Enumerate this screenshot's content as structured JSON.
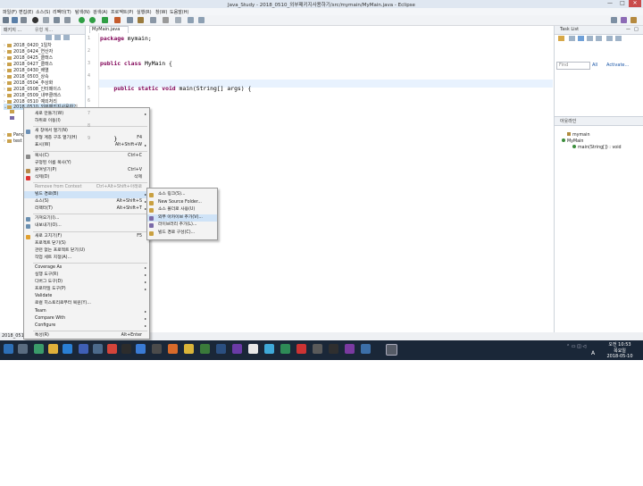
{
  "window": {
    "title": "Java_Study - 2018_0510_외부패키지사용하기/src/mymain/MyMain.java - Eclipse",
    "minimize": "—",
    "maximize": "□",
    "close": "✕"
  },
  "menubar": [
    "파일(F)",
    "편집(E)",
    "소스(S)",
    "리팩터(T)",
    "탐색(N)",
    "검색(A)",
    "프로젝트(P)",
    "실행(R)",
    "창(W)",
    "도움말(H)"
  ],
  "quick_access": "빠른 액세스",
  "package_explorer": {
    "tab_label": "패키지 ...",
    "tab2_label": "유형 계...",
    "items": [
      "2018_0420_1일차",
      "2018_0424_연산자",
      "2018_0425_클래스",
      "2018_0427_클래스",
      "2018_0430_배열",
      "2018_0503_상속",
      "2018_0504_추상화",
      "2018_0508_인터페이스",
      "2018_0509_내부클래스",
      "2018_0510_예외처리",
      "2018_0510_외부패키지사용하기"
    ],
    "extra_items": [
      "Pang",
      "test"
    ],
    "statusbar_label": "2018_0510_"
  },
  "editor": {
    "tab_label": "MyMain.java",
    "lines": [
      {
        "no": "1",
        "parts": [
          {
            "kw": true,
            "t": "package"
          },
          {
            "kw": false,
            "t": " mymain;"
          }
        ]
      },
      {
        "no": "2",
        "parts": []
      },
      {
        "no": "3",
        "parts": [
          {
            "kw": true,
            "t": "public class"
          },
          {
            "kw": false,
            "t": " MyMain {"
          }
        ]
      },
      {
        "no": "4",
        "parts": []
      },
      {
        "no": "5",
        "parts": [
          {
            "kw": false,
            "t": "    "
          },
          {
            "kw": true,
            "t": "public static void"
          },
          {
            "kw": false,
            "t": " main(String[] args) {"
          }
        ]
      },
      {
        "no": "6",
        "parts": []
      },
      {
        "no": "7",
        "parts": []
      },
      {
        "no": "8",
        "parts": []
      },
      {
        "no": "9",
        "parts": [
          {
            "kw": false,
            "t": "    }"
          }
        ]
      }
    ]
  },
  "task_list": {
    "title": "Task List",
    "find_placeholder": "Find",
    "all_label": "All",
    "activate_label": "Activate..."
  },
  "outline": {
    "title": "아웃라인",
    "items": [
      "mymain",
      "MyMain",
      "main(String[]) : void"
    ]
  },
  "context_menu": {
    "items": [
      {
        "label": "새로 만들기(W)",
        "shortcut": "",
        "submenu": true,
        "disabled": false
      },
      {
        "label": "하위로 이동(I)",
        "shortcut": "",
        "submenu": false,
        "disabled": false
      },
      {
        "sep": true
      },
      {
        "label": "새 창에서 열기(N)",
        "shortcut": "",
        "submenu": false,
        "disabled": false
      },
      {
        "label": "유형 계층 구조 열기(H)",
        "shortcut": "F4",
        "submenu": false,
        "disabled": false
      },
      {
        "label": "표시(W)",
        "shortcut": "Alt+Shift+W",
        "submenu": true,
        "disabled": false
      },
      {
        "sep": true
      },
      {
        "label": "복사(C)",
        "shortcut": "Ctrl+C",
        "submenu": false,
        "disabled": false
      },
      {
        "label": "규정된 이름 복사(Y)",
        "shortcut": "",
        "submenu": false,
        "disabled": false
      },
      {
        "label": "붙여넣기(P)",
        "shortcut": "Ctrl+V",
        "submenu": false,
        "disabled": false
      },
      {
        "label": "삭제(D)",
        "shortcut": "삭제",
        "submenu": false,
        "disabled": false
      },
      {
        "sep": true
      },
      {
        "label": "Remove from Context",
        "shortcut": "Ctrl+Alt+Shift+아래로",
        "submenu": false,
        "disabled": true
      },
      {
        "label": "빌드 경로(B)",
        "shortcut": "",
        "submenu": true,
        "disabled": false,
        "highlight": true
      },
      {
        "label": "소스(S)",
        "shortcut": "Alt+Shift+S",
        "submenu": true,
        "disabled": false
      },
      {
        "label": "리팩터(T)",
        "shortcut": "Alt+Shift+T",
        "submenu": true,
        "disabled": false
      },
      {
        "sep": true
      },
      {
        "label": "가져오기(I)...",
        "shortcut": "",
        "submenu": false,
        "disabled": false
      },
      {
        "label": "내보내기(O)...",
        "shortcut": "",
        "submenu": false,
        "disabled": false
      },
      {
        "sep": true
      },
      {
        "label": "새로 고치기(F)",
        "shortcut": "F5",
        "submenu": false,
        "disabled": false
      },
      {
        "label": "프로젝트 닫기(S)",
        "shortcut": "",
        "submenu": false,
        "disabled": false
      },
      {
        "label": "관련 없는 프로젝트 닫기(U)",
        "shortcut": "",
        "submenu": false,
        "disabled": false
      },
      {
        "label": "작업 세트 지정(A)...",
        "shortcut": "",
        "submenu": false,
        "disabled": false
      },
      {
        "sep": true
      },
      {
        "label": "Coverage As",
        "shortcut": "",
        "submenu": true,
        "disabled": false
      },
      {
        "label": "실행 도구(R)",
        "shortcut": "",
        "submenu": true,
        "disabled": false
      },
      {
        "label": "디버그 도구(D)",
        "shortcut": "",
        "submenu": true,
        "disabled": false
      },
      {
        "label": "프로파일 도구(P)",
        "shortcut": "",
        "submenu": true,
        "disabled": false
      },
      {
        "label": "Validate",
        "shortcut": "",
        "submenu": false,
        "disabled": false
      },
      {
        "label": "로컬 히스토리로부터 복원(Y)...",
        "shortcut": "",
        "submenu": false,
        "disabled": false
      },
      {
        "label": "Team",
        "shortcut": "",
        "submenu": true,
        "disabled": false
      },
      {
        "label": "Compare With",
        "shortcut": "",
        "submenu": true,
        "disabled": false
      },
      {
        "label": "Configure",
        "shortcut": "",
        "submenu": true,
        "disabled": false
      },
      {
        "sep": true
      },
      {
        "label": "특성(R)",
        "shortcut": "Alt+Enter",
        "submenu": false,
        "disabled": false
      }
    ]
  },
  "build_path_submenu": {
    "items": [
      {
        "label": "소스 링크(S)...",
        "highlight": false
      },
      {
        "label": "New Source Folder...",
        "highlight": false
      },
      {
        "label": "소스 폴더로 사용(U)",
        "highlight": false
      },
      {
        "label": "외부 아카이브 추가(V)...",
        "highlight": true
      },
      {
        "label": "라이브러리 추가(L)...",
        "highlight": false
      },
      {
        "label": "빌드 경로 구성(C)...",
        "highlight": false
      }
    ]
  },
  "taskbar": {
    "time": "오전 10:53",
    "day": "목요일",
    "date": "2018-05-10",
    "ime": "A"
  },
  "colors": {
    "accent": "#cfe3f7",
    "keyword": "#7f0055",
    "taskbar": "#1a2738"
  }
}
